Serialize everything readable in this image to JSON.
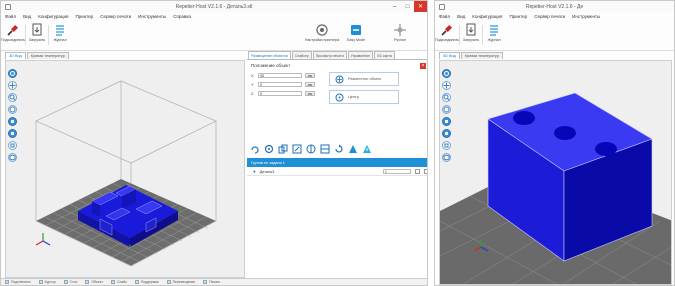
{
  "left_window": {
    "title": "Repetier-Host V2.1.6 - Деталь3.stl",
    "controls": [
      "–",
      "□",
      "✕"
    ],
    "menu": [
      "Файл",
      "Вид",
      "Конфигурация",
      "Принтер",
      "Сервер печати",
      "Инструменты",
      "Справка"
    ],
    "toolbar": [
      {
        "label": "Подсоединить",
        "icon": "connect-icon"
      },
      {
        "label": "Загрузить",
        "icon": "load-icon"
      },
      {
        "label": "Журнал",
        "icon": "log-icon"
      },
      {
        "label": "Настройки принтера",
        "icon": "printer-settings-icon"
      },
      {
        "label": "Easy Mode",
        "icon": "easy-mode-icon"
      },
      {
        "label": "Ручное",
        "icon": "manual-control-icon"
      }
    ],
    "view_tabs": [
      "3D Вид",
      "Кривая температур"
    ],
    "panel_tabs": [
      "Размещение объектов",
      "Слайсер",
      "Просмотр печати",
      "Управление",
      "SD карта"
    ],
    "section_title": "Положение объект",
    "coords": [
      {
        "axis": "X",
        "value": "95",
        "unit": "мм"
      },
      {
        "axis": "Y",
        "value": "0",
        "unit": "мм"
      },
      {
        "axis": "Z",
        "value": "0",
        "unit": "мм"
      }
    ],
    "actions": [
      "Разместить объект",
      "Центр"
    ],
    "layer_label": "Группа не задана 1",
    "object": {
      "name": "Деталь3",
      "value": "1"
    },
    "status": [
      "Подключено",
      "Курсор",
      "Стол",
      "Объект",
      "Слайс",
      "Поддержка",
      "Перемещение",
      "Печать"
    ]
  },
  "right_window": {
    "title": "Repetier-Host V2.1.6 - Де",
    "menu": [
      "Файл",
      "Вид",
      "Конфигурация",
      "Принтер",
      "Сервер печати",
      "Инструменты"
    ],
    "toolbar": [
      {
        "label": "Подсоединить",
        "icon": "connect-icon"
      },
      {
        "label": "Загрузить",
        "icon": "load-icon"
      },
      {
        "label": "Журнал",
        "icon": "log-icon"
      }
    ],
    "view_tabs": [
      "3D Вид",
      "Кривая температур"
    ]
  },
  "colors": {
    "model_blue": "#1a1adb",
    "accent": "#1f8fd6",
    "close_red": "#d9362b",
    "grid": "#9a9a9a"
  }
}
